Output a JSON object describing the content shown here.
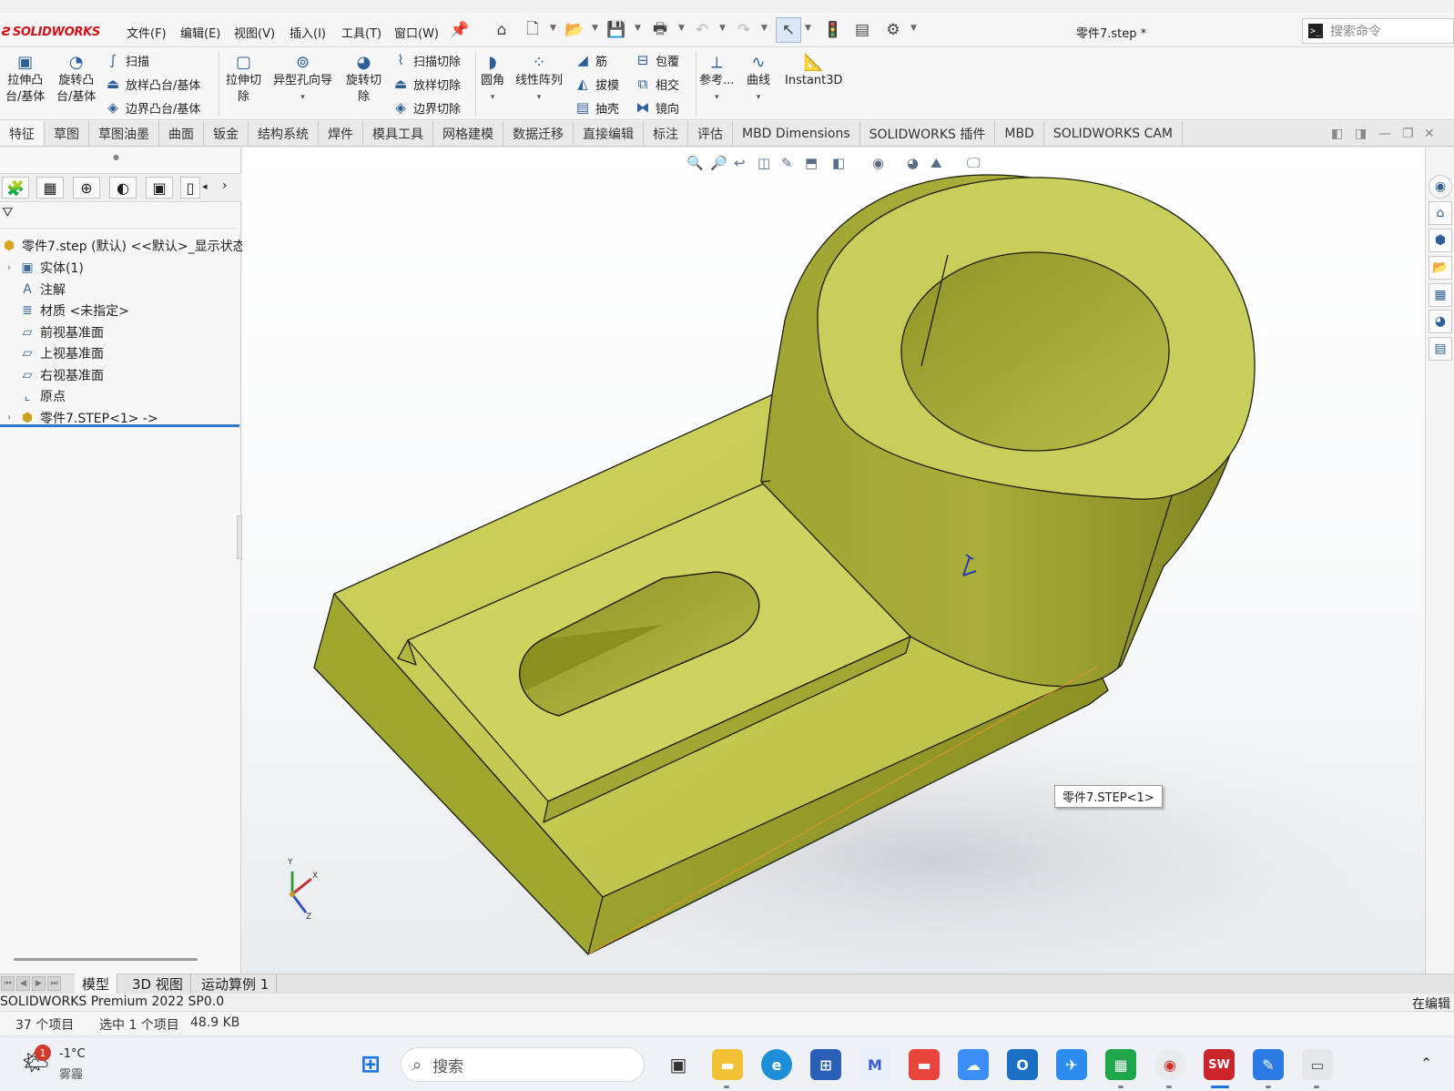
{
  "app": {
    "brand": "SOLIDWORKS",
    "menus": [
      "文件(F)",
      "编辑(E)",
      "视图(V)",
      "插入(I)",
      "工具(T)",
      "窗口(W)"
    ],
    "document_title": "零件7.step *",
    "command_search_placeholder": "搜索命令"
  },
  "ribbon": {
    "extrude_boss": [
      "拉伸凸",
      "台/基体"
    ],
    "revolve_boss": [
      "旋转凸",
      "台/基体"
    ],
    "sweep": "扫描",
    "loft_boss": "放样凸台/基体",
    "boundary_boss": "边界凸台/基体",
    "extrude_cut": [
      "拉伸切",
      "除"
    ],
    "hole_wizard": "异型孔向导",
    "revolve_cut": [
      "旋转切",
      "除"
    ],
    "swept_cut": "扫描切除",
    "lofted_cut": "放样切除",
    "boundary_cut": "边界切除",
    "fillet": "圆角",
    "linear_pattern": "线性阵列",
    "rib": "筋",
    "draft": "拔模",
    "shell": "抽壳",
    "wrap": "包覆",
    "intersect": "相交",
    "mirror": "镜向",
    "reference": "参考...",
    "curves": "曲线",
    "instant3d": "Instant3D"
  },
  "tabs": [
    "特征",
    "草图",
    "草图油墨",
    "曲面",
    "钣金",
    "结构系统",
    "焊件",
    "模具工具",
    "网格建模",
    "数据迁移",
    "直接编辑",
    "标注",
    "评估",
    "MBD Dimensions",
    "SOLIDWORKS 插件",
    "MBD",
    "SOLIDWORKS CAM"
  ],
  "tree": {
    "root": "零件7.step (默认) <<默认>_显示状态",
    "items": [
      {
        "label": "实体(1)",
        "icon": "solid-bodies-icon",
        "toggle": true
      },
      {
        "label": "注解",
        "icon": "annotations-icon",
        "toggle": false
      },
      {
        "label": "材质 <未指定>",
        "icon": "material-icon",
        "toggle": false
      },
      {
        "label": "前视基准面",
        "icon": "plane-icon",
        "toggle": false
      },
      {
        "label": "上视基准面",
        "icon": "plane-icon",
        "toggle": false
      },
      {
        "label": "右视基准面",
        "icon": "plane-icon",
        "toggle": false
      },
      {
        "label": "原点",
        "icon": "origin-icon",
        "toggle": false
      },
      {
        "label": "零件7.STEP<1> ->",
        "icon": "imported-feature-icon",
        "toggle": true
      }
    ]
  },
  "viewport": {
    "tooltip": "零件7.STEP<1>",
    "model_color": "#c6cc55",
    "triad_labels": {
      "x": "X",
      "y": "Y",
      "z": "Z"
    }
  },
  "bottom_tabs": [
    "模型",
    "3D 视图",
    "运动算例 1"
  ],
  "status": {
    "version": "SOLIDWORKS Premium 2022 SP0.0",
    "mode": "在编辑"
  },
  "explorer_status": {
    "items": "37 个项目",
    "selected": "选中 1 个项目",
    "size": "48.9 KB"
  },
  "taskbar": {
    "weather_temp": "-1°C",
    "weather_desc": "雾霾",
    "weather_badge": "1",
    "search_placeholder": "搜索",
    "sw_badge": "SW"
  }
}
